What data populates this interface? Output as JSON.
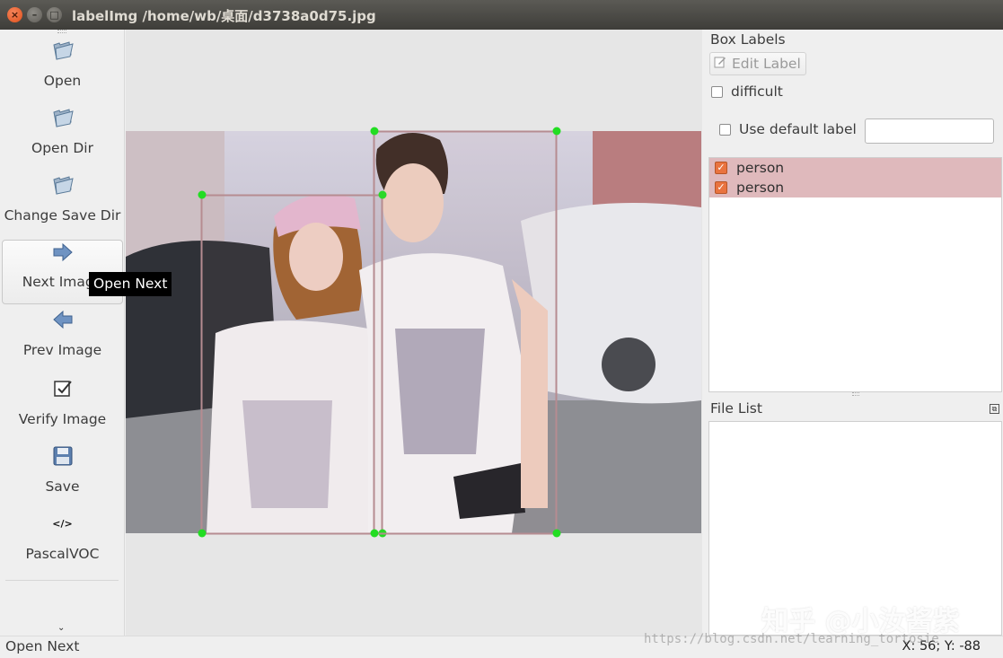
{
  "window": {
    "title": "labelImg /home/wb/桌面/d3738a0d75.jpg",
    "close_glyph": "×",
    "min_glyph": "–",
    "max_glyph": "□"
  },
  "toolbar": {
    "items": [
      {
        "label": "Open",
        "icon": "folder-open-icon"
      },
      {
        "label": "Open Dir",
        "icon": "folder-open-icon"
      },
      {
        "label": "Change Save Dir",
        "icon": "folder-open-icon"
      },
      {
        "label": "Next Image",
        "icon": "arrow-right-icon"
      },
      {
        "label": "Prev Image",
        "icon": "arrow-left-icon"
      },
      {
        "label": "Verify Image",
        "icon": "checkbox-icon"
      },
      {
        "label": "Save",
        "icon": "floppy-disk-icon"
      },
      {
        "label": "PascalVOC",
        "icon": "code-tag-icon",
        "glyph": "</>"
      }
    ],
    "more_glyph": "⌄"
  },
  "tooltip": {
    "text": "Open Next"
  },
  "box_labels": {
    "title": "Box Labels",
    "edit_label": "Edit Label",
    "difficult": "difficult",
    "use_default_label": "Use default label",
    "default_label_value": "",
    "labels": [
      {
        "name": "person",
        "checked": true
      },
      {
        "name": "person",
        "checked": true
      }
    ]
  },
  "file_list": {
    "title": "File List",
    "files": []
  },
  "status": {
    "message": "Open Next",
    "coords": "X: 56; Y: -88"
  },
  "watermark": {
    "text": "知乎 @小汝酱紫",
    "url": "https://blog.csdn.net/learning_tortosie"
  },
  "colors": {
    "box_stroke": "#b68c91",
    "vertex": "#22dd22",
    "label_bg": "#dfb9bc",
    "checkbox": "#e9733f"
  }
}
